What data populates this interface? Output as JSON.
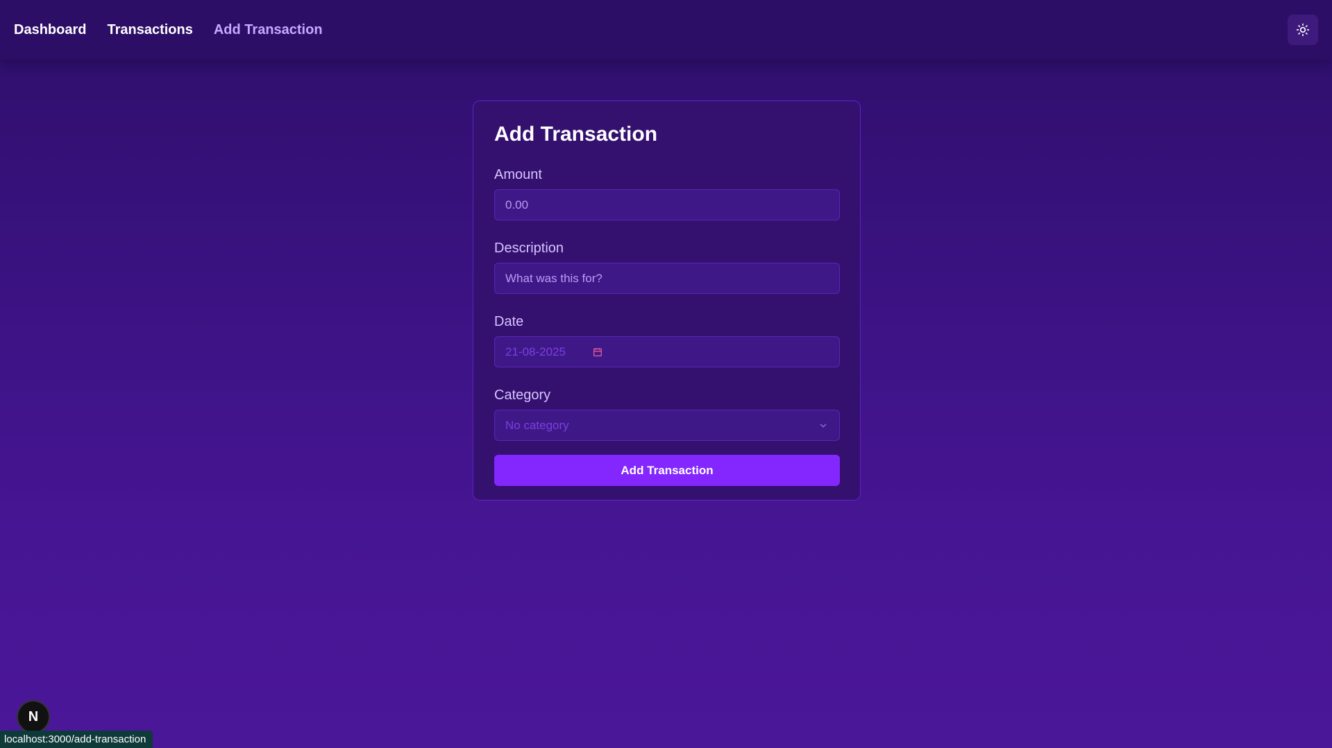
{
  "nav": {
    "links": [
      {
        "label": "Dashboard"
      },
      {
        "label": "Transactions"
      },
      {
        "label": "Add Transaction"
      }
    ],
    "theme_toggle_icon": "sun-icon"
  },
  "form": {
    "title": "Add Transaction",
    "amount": {
      "label": "Amount",
      "placeholder": "0.00"
    },
    "description": {
      "label": "Description",
      "placeholder": "What was this for?"
    },
    "date": {
      "label": "Date",
      "value": "21-08-2025"
    },
    "category": {
      "label": "Category",
      "value": "No category"
    },
    "submit_label": "Add Transaction"
  },
  "next_badge": "N",
  "status_url": "localhost:3000/add-transaction",
  "colors": {
    "accent": "#8427ff",
    "active_nav": "#c9a8ff",
    "background": "#3a1280"
  }
}
